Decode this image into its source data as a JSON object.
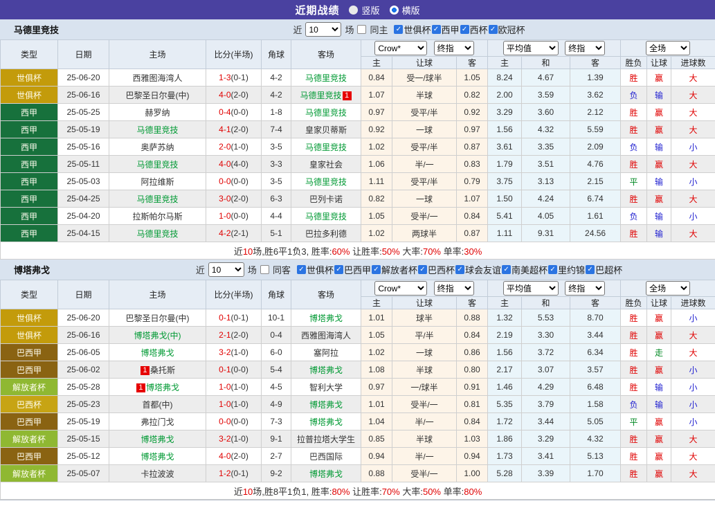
{
  "titlebar": {
    "title": "近期战绩",
    "vertical_label": "竖版",
    "horizontal_label": "横版"
  },
  "header": {
    "info": [
      "类型",
      "日期",
      "主场",
      "比分(半场)",
      "角球",
      "客场"
    ],
    "sub": [
      "主",
      "让球",
      "客",
      "主",
      "和",
      "客",
      "胜负",
      "让球",
      "进球数"
    ],
    "dropdowns": {
      "company": "Crow*",
      "final_a": "终指",
      "average": "平均值",
      "final_b": "终指",
      "scope": "全场"
    }
  },
  "colors": {
    "accent_purple": "#4a41a0",
    "team_green": "#009933",
    "win_red": "#e00000",
    "lose_blue": "#2020d0",
    "draw_green": "#008822",
    "badge_club_worldcup": "#c39b0b",
    "badge_laliga": "#17713c",
    "badge_brazil_serie_a": "#8a6312",
    "badge_libertadores": "#8fb832",
    "badge_brazil_cup": "#c7a414"
  },
  "sections": [
    {
      "team": "马德里竞技",
      "filter": {
        "near": "近",
        "count": "10",
        "games": "场",
        "same": "同主",
        "leagues": [
          "世俱杯",
          "西甲",
          "西杯",
          "欧冠杯"
        ]
      },
      "rows": [
        {
          "type": "世俱杯",
          "type_color": "#c39b0b",
          "date": "25-06-20",
          "home": "西雅图海湾人",
          "home_green": false,
          "home_badge": "",
          "score": "1-3",
          "half": "(0-1)",
          "corner": "4-2",
          "away": "马德里竞技",
          "away_green": true,
          "away_badge": "",
          "h": "0.84",
          "hc": "受一/球半",
          "a": "1.05",
          "eh": "8.24",
          "ed": "4.67",
          "ea": "1.39",
          "r1": "胜",
          "r1c": "red",
          "r2": "赢",
          "r2c": "red",
          "r3": "大",
          "r3c": "red"
        },
        {
          "type": "世俱杯",
          "type_color": "#c39b0b",
          "date": "25-06-16",
          "home": "巴黎圣日尔曼(中)",
          "home_green": false,
          "home_badge": "",
          "score": "4-0",
          "half": "(2-0)",
          "corner": "4-2",
          "away": "马德里竞技",
          "away_green": true,
          "away_badge": "1",
          "h": "1.07",
          "hc": "半球",
          "a": "0.82",
          "eh": "2.00",
          "ed": "3.59",
          "ea": "3.62",
          "r1": "负",
          "r1c": "blue",
          "r2": "输",
          "r2c": "blue",
          "r3": "大",
          "r3c": "red"
        },
        {
          "type": "西甲",
          "type_color": "#17713c",
          "date": "25-05-25",
          "home": "赫罗纳",
          "home_green": false,
          "home_badge": "",
          "score": "0-4",
          "half": "(0-0)",
          "corner": "1-8",
          "away": "马德里竞技",
          "away_green": true,
          "away_badge": "",
          "h": "0.97",
          "hc": "受平/半",
          "a": "0.92",
          "eh": "3.29",
          "ed": "3.60",
          "ea": "2.12",
          "r1": "胜",
          "r1c": "red",
          "r2": "赢",
          "r2c": "red",
          "r3": "大",
          "r3c": "red"
        },
        {
          "type": "西甲",
          "type_color": "#17713c",
          "date": "25-05-19",
          "home": "马德里竞技",
          "home_green": true,
          "home_badge": "",
          "score": "4-1",
          "half": "(2-0)",
          "corner": "7-4",
          "away": "皇家贝蒂斯",
          "away_green": false,
          "away_badge": "",
          "h": "0.92",
          "hc": "一球",
          "a": "0.97",
          "eh": "1.56",
          "ed": "4.32",
          "ea": "5.59",
          "r1": "胜",
          "r1c": "red",
          "r2": "赢",
          "r2c": "red",
          "r3": "大",
          "r3c": "red"
        },
        {
          "type": "西甲",
          "type_color": "#17713c",
          "date": "25-05-16",
          "home": "奥萨苏纳",
          "home_green": false,
          "home_badge": "",
          "score": "2-0",
          "half": "(1-0)",
          "corner": "3-5",
          "away": "马德里竞技",
          "away_green": true,
          "away_badge": "",
          "h": "1.02",
          "hc": "受平/半",
          "a": "0.87",
          "eh": "3.61",
          "ed": "3.35",
          "ea": "2.09",
          "r1": "负",
          "r1c": "blue",
          "r2": "输",
          "r2c": "blue",
          "r3": "小",
          "r3c": "blue"
        },
        {
          "type": "西甲",
          "type_color": "#17713c",
          "date": "25-05-11",
          "home": "马德里竞技",
          "home_green": true,
          "home_badge": "",
          "score": "4-0",
          "half": "(4-0)",
          "corner": "3-3",
          "away": "皇家社会",
          "away_green": false,
          "away_badge": "",
          "h": "1.06",
          "hc": "半/一",
          "a": "0.83",
          "eh": "1.79",
          "ed": "3.51",
          "ea": "4.76",
          "r1": "胜",
          "r1c": "red",
          "r2": "赢",
          "r2c": "red",
          "r3": "大",
          "r3c": "red"
        },
        {
          "type": "西甲",
          "type_color": "#17713c",
          "date": "25-05-03",
          "home": "阿拉维斯",
          "home_green": false,
          "home_badge": "",
          "score": "0-0",
          "half": "(0-0)",
          "corner": "3-5",
          "away": "马德里竞技",
          "away_green": true,
          "away_badge": "",
          "h": "1.11",
          "hc": "受平/半",
          "a": "0.79",
          "eh": "3.75",
          "ed": "3.13",
          "ea": "2.15",
          "r1": "平",
          "r1c": "green",
          "r2": "输",
          "r2c": "blue",
          "r3": "小",
          "r3c": "blue"
        },
        {
          "type": "西甲",
          "type_color": "#17713c",
          "date": "25-04-25",
          "home": "马德里竞技",
          "home_green": true,
          "home_badge": "",
          "score": "3-0",
          "half": "(2-0)",
          "corner": "6-3",
          "away": "巴列卡诺",
          "away_green": false,
          "away_badge": "",
          "h": "0.82",
          "hc": "一球",
          "a": "1.07",
          "eh": "1.50",
          "ed": "4.24",
          "ea": "6.74",
          "r1": "胜",
          "r1c": "red",
          "r2": "赢",
          "r2c": "red",
          "r3": "大",
          "r3c": "red"
        },
        {
          "type": "西甲",
          "type_color": "#17713c",
          "date": "25-04-20",
          "home": "拉斯帕尔马斯",
          "home_green": false,
          "home_badge": "",
          "score": "1-0",
          "half": "(0-0)",
          "corner": "4-4",
          "away": "马德里竞技",
          "away_green": true,
          "away_badge": "",
          "h": "1.05",
          "hc": "受半/一",
          "a": "0.84",
          "eh": "5.41",
          "ed": "4.05",
          "ea": "1.61",
          "r1": "负",
          "r1c": "blue",
          "r2": "输",
          "r2c": "blue",
          "r3": "小",
          "r3c": "blue"
        },
        {
          "type": "西甲",
          "type_color": "#17713c",
          "date": "25-04-15",
          "home": "马德里竞技",
          "home_green": true,
          "home_badge": "",
          "score": "4-2",
          "half": "(2-1)",
          "corner": "5-1",
          "away": "巴拉多利德",
          "away_green": false,
          "away_badge": "",
          "h": "1.02",
          "hc": "两球半",
          "a": "0.87",
          "eh": "1.11",
          "ed": "9.31",
          "ea": "24.56",
          "r1": "胜",
          "r1c": "red",
          "r2": "输",
          "r2c": "blue",
          "r3": "大",
          "r3c": "red"
        }
      ],
      "summary": {
        "t1": "近",
        "v1": "10",
        "t2": "场,胜6平1负3, 胜率:",
        "v2": "60%",
        "t3": " 让胜率:",
        "v3": "50%",
        "t4": " 大率:",
        "v4": "70%",
        "t5": " 单率:",
        "v5": "30%"
      }
    },
    {
      "team": "博塔弗戈",
      "filter": {
        "near": "近",
        "count": "10",
        "games": "场",
        "same": "同客",
        "leagues": [
          "世俱杯",
          "巴西甲",
          "解放者杯",
          "巴西杯",
          "球会友谊",
          "南美超杯",
          "里约锦",
          "巴超杯"
        ]
      },
      "rows": [
        {
          "type": "世俱杯",
          "type_color": "#c39b0b",
          "date": "25-06-20",
          "home": "巴黎圣日尔曼(中)",
          "home_green": false,
          "home_badge": "",
          "score": "0-1",
          "half": "(0-1)",
          "corner": "10-1",
          "away": "博塔弗戈",
          "away_green": true,
          "away_badge": "",
          "h": "1.01",
          "hc": "球半",
          "a": "0.88",
          "eh": "1.32",
          "ed": "5.53",
          "ea": "8.70",
          "r1": "胜",
          "r1c": "red",
          "r2": "赢",
          "r2c": "red",
          "r3": "小",
          "r3c": "blue"
        },
        {
          "type": "世俱杯",
          "type_color": "#c39b0b",
          "date": "25-06-16",
          "home": "博塔弗戈(中)",
          "home_green": true,
          "home_badge": "",
          "score": "2-1",
          "half": "(2-0)",
          "corner": "0-4",
          "away": "西雅图海湾人",
          "away_green": false,
          "away_badge": "",
          "h": "1.05",
          "hc": "平/半",
          "a": "0.84",
          "eh": "2.19",
          "ed": "3.30",
          "ea": "3.44",
          "r1": "胜",
          "r1c": "red",
          "r2": "赢",
          "r2c": "red",
          "r3": "大",
          "r3c": "red"
        },
        {
          "type": "巴西甲",
          "type_color": "#8a6312",
          "date": "25-06-05",
          "home": "博塔弗戈",
          "home_green": true,
          "home_badge": "",
          "score": "3-2",
          "half": "(1-0)",
          "corner": "6-0",
          "away": "塞阿拉",
          "away_green": false,
          "away_badge": "",
          "h": "1.02",
          "hc": "一球",
          "a": "0.86",
          "eh": "1.56",
          "ed": "3.72",
          "ea": "6.34",
          "r1": "胜",
          "r1c": "red",
          "r2": "走",
          "r2c": "green",
          "r3": "大",
          "r3c": "red"
        },
        {
          "type": "巴西甲",
          "type_color": "#8a6312",
          "date": "25-06-02",
          "home": "桑托斯",
          "home_green": false,
          "home_badge": "1",
          "score": "0-1",
          "half": "(0-0)",
          "corner": "5-4",
          "away": "博塔弗戈",
          "away_green": true,
          "away_badge": "",
          "h": "1.08",
          "hc": "半球",
          "a": "0.80",
          "eh": "2.17",
          "ed": "3.07",
          "ea": "3.57",
          "r1": "胜",
          "r1c": "red",
          "r2": "赢",
          "r2c": "red",
          "r3": "小",
          "r3c": "blue"
        },
        {
          "type": "解放者杯",
          "type_color": "#8fb832",
          "date": "25-05-28",
          "home": "博塔弗戈",
          "home_green": true,
          "home_badge": "1",
          "score": "1-0",
          "half": "(1-0)",
          "corner": "4-5",
          "away": "智利大学",
          "away_green": false,
          "away_badge": "",
          "h": "0.97",
          "hc": "一/球半",
          "a": "0.91",
          "eh": "1.46",
          "ed": "4.29",
          "ea": "6.48",
          "r1": "胜",
          "r1c": "red",
          "r2": "输",
          "r2c": "blue",
          "r3": "小",
          "r3c": "blue"
        },
        {
          "type": "巴西杯",
          "type_color": "#c7a414",
          "date": "25-05-23",
          "home": "首都(中)",
          "home_green": false,
          "home_badge": "",
          "score": "1-0",
          "half": "(1-0)",
          "corner": "4-9",
          "away": "博塔弗戈",
          "away_green": true,
          "away_badge": "",
          "h": "1.01",
          "hc": "受半/一",
          "a": "0.81",
          "eh": "5.35",
          "ed": "3.79",
          "ea": "1.58",
          "r1": "负",
          "r1c": "blue",
          "r2": "输",
          "r2c": "blue",
          "r3": "小",
          "r3c": "blue"
        },
        {
          "type": "巴西甲",
          "type_color": "#8a6312",
          "date": "25-05-19",
          "home": "弗拉门戈",
          "home_green": false,
          "home_badge": "",
          "score": "0-0",
          "half": "(0-0)",
          "corner": "7-3",
          "away": "博塔弗戈",
          "away_green": true,
          "away_badge": "",
          "h": "1.04",
          "hc": "半/一",
          "a": "0.84",
          "eh": "1.72",
          "ed": "3.44",
          "ea": "5.05",
          "r1": "平",
          "r1c": "green",
          "r2": "赢",
          "r2c": "red",
          "r3": "小",
          "r3c": "blue"
        },
        {
          "type": "解放者杯",
          "type_color": "#8fb832",
          "date": "25-05-15",
          "home": "博塔弗戈",
          "home_green": true,
          "home_badge": "",
          "score": "3-2",
          "half": "(1-0)",
          "corner": "9-1",
          "away": "拉普拉塔大学生",
          "away_green": false,
          "away_badge": "",
          "h": "0.85",
          "hc": "半球",
          "a": "1.03",
          "eh": "1.86",
          "ed": "3.29",
          "ea": "4.32",
          "r1": "胜",
          "r1c": "red",
          "r2": "赢",
          "r2c": "red",
          "r3": "大",
          "r3c": "red"
        },
        {
          "type": "巴西甲",
          "type_color": "#8a6312",
          "date": "25-05-12",
          "home": "博塔弗戈",
          "home_green": true,
          "home_badge": "",
          "score": "4-0",
          "half": "(2-0)",
          "corner": "2-7",
          "away": "巴西国际",
          "away_green": false,
          "away_badge": "",
          "h": "0.94",
          "hc": "半/一",
          "a": "0.94",
          "eh": "1.73",
          "ed": "3.41",
          "ea": "5.13",
          "r1": "胜",
          "r1c": "red",
          "r2": "赢",
          "r2c": "red",
          "r3": "大",
          "r3c": "red"
        },
        {
          "type": "解放者杯",
          "type_color": "#8fb832",
          "date": "25-05-07",
          "home": "卡拉波波",
          "home_green": false,
          "home_badge": "",
          "score": "1-2",
          "half": "(0-1)",
          "corner": "9-2",
          "away": "博塔弗戈",
          "away_green": true,
          "away_badge": "",
          "h": "0.88",
          "hc": "受半/一",
          "a": "1.00",
          "eh": "5.28",
          "ed": "3.39",
          "ea": "1.70",
          "r1": "胜",
          "r1c": "red",
          "r2": "赢",
          "r2c": "red",
          "r3": "大",
          "r3c": "red"
        }
      ],
      "summary": {
        "t1": "近",
        "v1": "10",
        "t2": "场,胜8平1负1, 胜率:",
        "v2": "80%",
        "t3": " 让胜率:",
        "v3": "70%",
        "t4": " 大率:",
        "v4": "50%",
        "t5": " 单率:",
        "v5": "80%"
      }
    }
  ]
}
